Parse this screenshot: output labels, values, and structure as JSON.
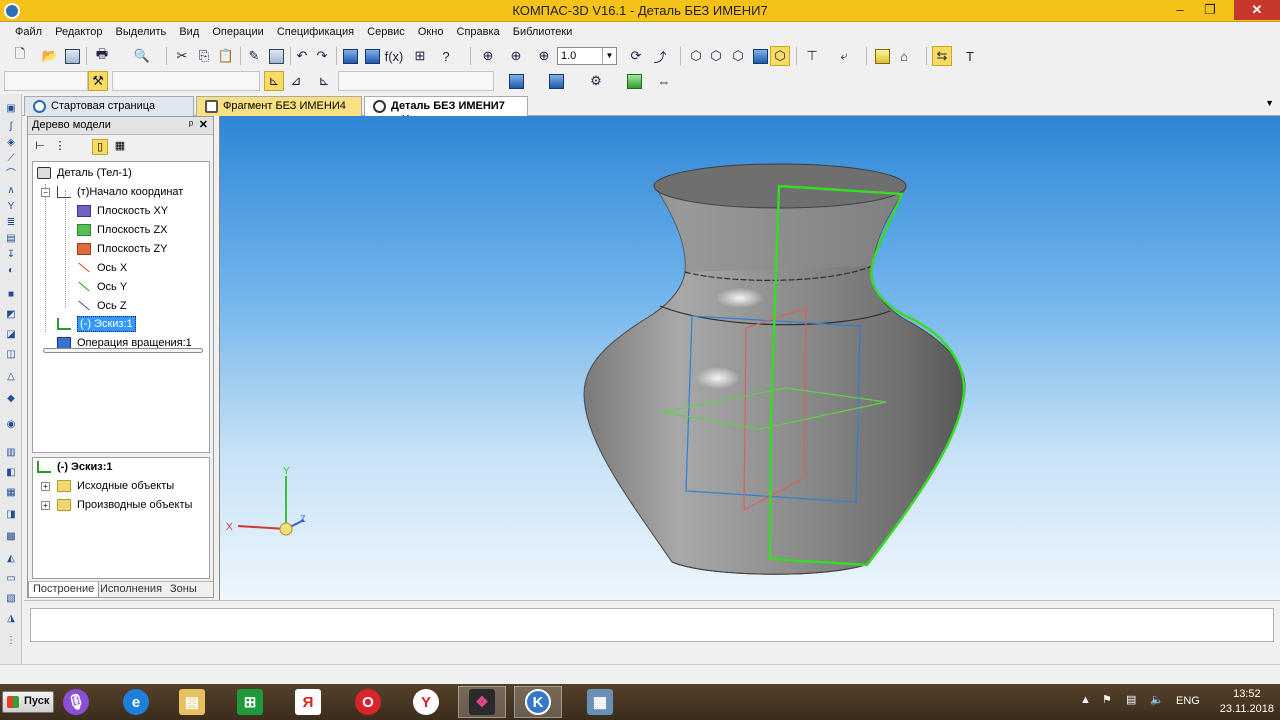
{
  "window": {
    "title": "КОМПАС-3D V16.1 - Деталь БЕЗ ИМЕНИ7",
    "buttons": {
      "minimize": "–",
      "maximize": "❐",
      "close": "✕"
    }
  },
  "menu": [
    "Файл",
    "Редактор",
    "Выделить",
    "Вид",
    "Операции",
    "Спецификация",
    "Сервис",
    "Окно",
    "Справка",
    "Библиотеки"
  ],
  "toolbar": {
    "zoom_value": "1.0"
  },
  "tabs": [
    {
      "label": "Стартовая страница"
    },
    {
      "label": "Фрагмент БЕЗ ИМЕНИ4"
    },
    {
      "label": "Деталь БЕЗ ИМЕНИ7",
      "close": "✕"
    }
  ],
  "model_tree": {
    "title": "Дерево модели",
    "pin": "ᵖ",
    "close": "✕",
    "nodes": [
      "Деталь (Тел-1)",
      "(т)Начало координат",
      "Плоскость XY",
      "Плоскость ZX",
      "Плоскость ZY",
      "Ось X",
      "Ось Y",
      "Ось Z",
      "(-) Эскиз:1",
      "Операция вращения:1"
    ],
    "detail_nodes": [
      "(-) Эскиз:1",
      "Исходные объекты",
      "Производные объекты"
    ],
    "bottom_tabs": [
      "Построение",
      "Исполнения",
      "Зоны"
    ]
  },
  "viewport": {
    "axis_x": "X",
    "axis_y": "Y",
    "axis_z": "Z"
  },
  "taskbar": {
    "start": "Пуск",
    "lang": "ENG",
    "time": "13:52",
    "date": "23.11.2018",
    "apps": [
      "mic-icon",
      "ie-icon",
      "explorer-icon",
      "store-icon",
      "yandex-browser-icon",
      "opera-icon",
      "yandex-icon",
      "media-icon",
      "kompas-icon",
      "app-icon"
    ]
  },
  "colors": {
    "titlebar": "#f5c21a",
    "selection": "#3399ff",
    "sketch_green": "#33dd22"
  }
}
